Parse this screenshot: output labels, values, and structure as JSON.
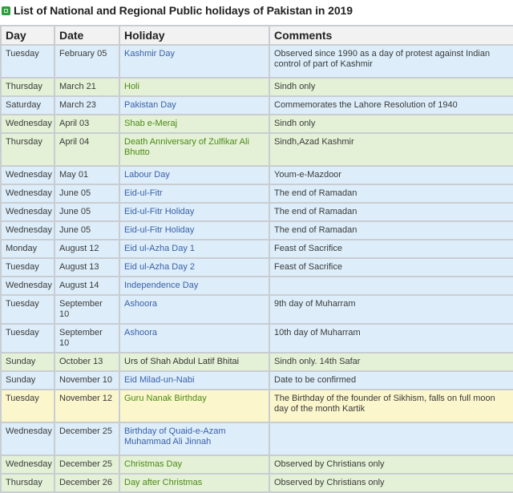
{
  "title": "List of National and Regional Public holidays of Pakistan in 2019",
  "columns": [
    "Day",
    "Date",
    "Holiday",
    "Comments"
  ],
  "colors": {
    "national_bg": "#ddeefa",
    "regional_bg": "#e4f1d6",
    "special_bg": "#fbf6cc",
    "national_link": "#3a5fa8",
    "regional_link": "#4b8a14"
  },
  "rows": [
    {
      "day": "Tuesday",
      "date": "February 05",
      "holiday": "Kashmir Day",
      "comments": "Observed since 1990 as a day of protest against Indian control of part of Kashmir",
      "type": "national"
    },
    {
      "day": "Thursday",
      "date": "March 21",
      "holiday": "Holi",
      "comments": "Sindh only",
      "type": "regional"
    },
    {
      "day": "Saturday",
      "date": "March 23",
      "holiday": "Pakistan Day",
      "comments": "Commemorates the Lahore Resolution of 1940",
      "type": "national"
    },
    {
      "day": "Wednesday",
      "date": "April 03",
      "holiday": "Shab e-Meraj",
      "comments": "Sindh only",
      "type": "regional"
    },
    {
      "day": "Thursday",
      "date": "April 04",
      "holiday": "Death Anniversary of Zulfikar Ali Bhutto",
      "comments": "Sindh,Azad Kashmir",
      "type": "regional"
    },
    {
      "day": "Wednesday",
      "date": "May 01",
      "holiday": "Labour Day",
      "comments": "Youm-e-Mazdoor",
      "type": "national"
    },
    {
      "day": "Wednesday",
      "date": "June 05",
      "holiday": "Eid-ul-Fitr",
      "comments": "The end of Ramadan",
      "type": "national"
    },
    {
      "day": "Wednesday",
      "date": "June 05",
      "holiday": "Eid-ul-Fitr Holiday",
      "comments": "The end of Ramadan",
      "type": "national"
    },
    {
      "day": "Wednesday",
      "date": "June 05",
      "holiday": "Eid-ul-Fitr Holiday",
      "comments": "The end of Ramadan",
      "type": "national"
    },
    {
      "day": "Monday",
      "date": "August 12",
      "holiday": "Eid ul-Azha Day 1",
      "comments": "Feast of Sacrifice",
      "type": "national"
    },
    {
      "day": "Tuesday",
      "date": "August 13",
      "holiday": "Eid ul-Azha Day 2",
      "comments": "Feast of Sacrifice",
      "type": "national"
    },
    {
      "day": "Wednesday",
      "date": "August 14",
      "holiday": "Independence Day",
      "comments": "",
      "type": "national"
    },
    {
      "day": "Tuesday",
      "date": "September 10",
      "holiday": "Ashoora",
      "comments": "9th day of Muharram",
      "type": "national"
    },
    {
      "day": "Tuesday",
      "date": "September 10",
      "holiday": "Ashoora",
      "comments": "10th day of Muharram",
      "type": "national"
    },
    {
      "day": "Sunday",
      "date": "October 13",
      "holiday": "Urs of Shah Abdul Latif Bhitai",
      "comments": "Sindh only. 14th Safar",
      "type": "regional-plain"
    },
    {
      "day": "Sunday",
      "date": "November 10",
      "holiday": "Eid Milad-un-Nabi",
      "comments": "Date to be confirmed",
      "type": "national"
    },
    {
      "day": "Tuesday",
      "date": "November 12",
      "holiday": "Guru Nanak Birthday",
      "comments": "The Birthday of the founder of Sikhism, falls on full moon day of the month Kartik",
      "type": "yellow"
    },
    {
      "day": "Wednesday",
      "date": "December 25",
      "holiday": "Birthday of Quaid-e-Azam Muhammad Ali Jinnah",
      "comments": "",
      "type": "national"
    },
    {
      "day": "Wednesday",
      "date": "December 25",
      "holiday": "Christmas Day",
      "comments": "Observed by Christians only",
      "type": "regional"
    },
    {
      "day": "Thursday",
      "date": "December 26",
      "holiday": "Day after Christmas",
      "comments": "Observed by Christians only",
      "type": "regional"
    }
  ]
}
